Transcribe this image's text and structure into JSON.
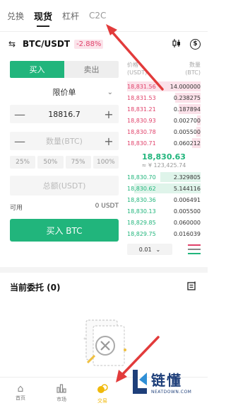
{
  "top_tabs": [
    "兑换",
    "现货",
    "杠杆",
    "C2C"
  ],
  "pair": {
    "name": "BTC/USDT",
    "change": "-2.88%"
  },
  "trade": {
    "buy_tab": "买入",
    "sell_tab": "卖出",
    "order_type": "限价单",
    "price": "18816.7",
    "amount_placeholder": "数量(BTC)",
    "percents": [
      "25%",
      "50%",
      "75%",
      "100%"
    ],
    "total_placeholder": "总额(USDT)",
    "available_label": "可用",
    "available_value": "0 USDT",
    "buy_button": "买入 BTC"
  },
  "order_book": {
    "price_header": "价格\n(USDT)",
    "amount_header": "数量\n(BTC)",
    "asks": [
      {
        "price": "18,831.56",
        "amount": "14.000000",
        "depth": 1.0
      },
      {
        "price": "18,831.53",
        "amount": "0.238275",
        "depth": 0.35
      },
      {
        "price": "18,831.21",
        "amount": "0.187894",
        "depth": 0.3
      },
      {
        "price": "18,830.93",
        "amount": "0.002700",
        "depth": 0.05
      },
      {
        "price": "18,830.78",
        "amount": "0.005500",
        "depth": 0.06
      },
      {
        "price": "18,830.71",
        "amount": "0.060212",
        "depth": 0.12
      }
    ],
    "mid_price": "18,830.63",
    "mid_cny": "≈ ¥ 123,425.74",
    "bids": [
      {
        "price": "18,830.70",
        "amount": "2.329805",
        "depth": 0.55
      },
      {
        "price": "18,830.62",
        "amount": "5.144116",
        "depth": 0.9
      },
      {
        "price": "18,830.36",
        "amount": "0.006491",
        "depth": 0.0
      },
      {
        "price": "18,830.13",
        "amount": "0.005500",
        "depth": 0.0
      },
      {
        "price": "18,829.85",
        "amount": "0.060000",
        "depth": 0.0
      },
      {
        "price": "18,829.75",
        "amount": "0.016039",
        "depth": 0.0
      }
    ],
    "precision": "0.01"
  },
  "current_orders": {
    "title": "当前委托 (0)"
  },
  "nav": [
    {
      "label": "首页",
      "icon": "home-icon"
    },
    {
      "label": "市场",
      "icon": "market-icon"
    },
    {
      "label": "交易",
      "icon": "trade-icon"
    }
  ],
  "watermark": {
    "cn": "链懂",
    "en": "NEATDOWN.COM"
  },
  "colors": {
    "green": "#21b57c",
    "red": "#e0416a",
    "yellow": "#f0b90b",
    "arrow": "#e23b3b"
  }
}
